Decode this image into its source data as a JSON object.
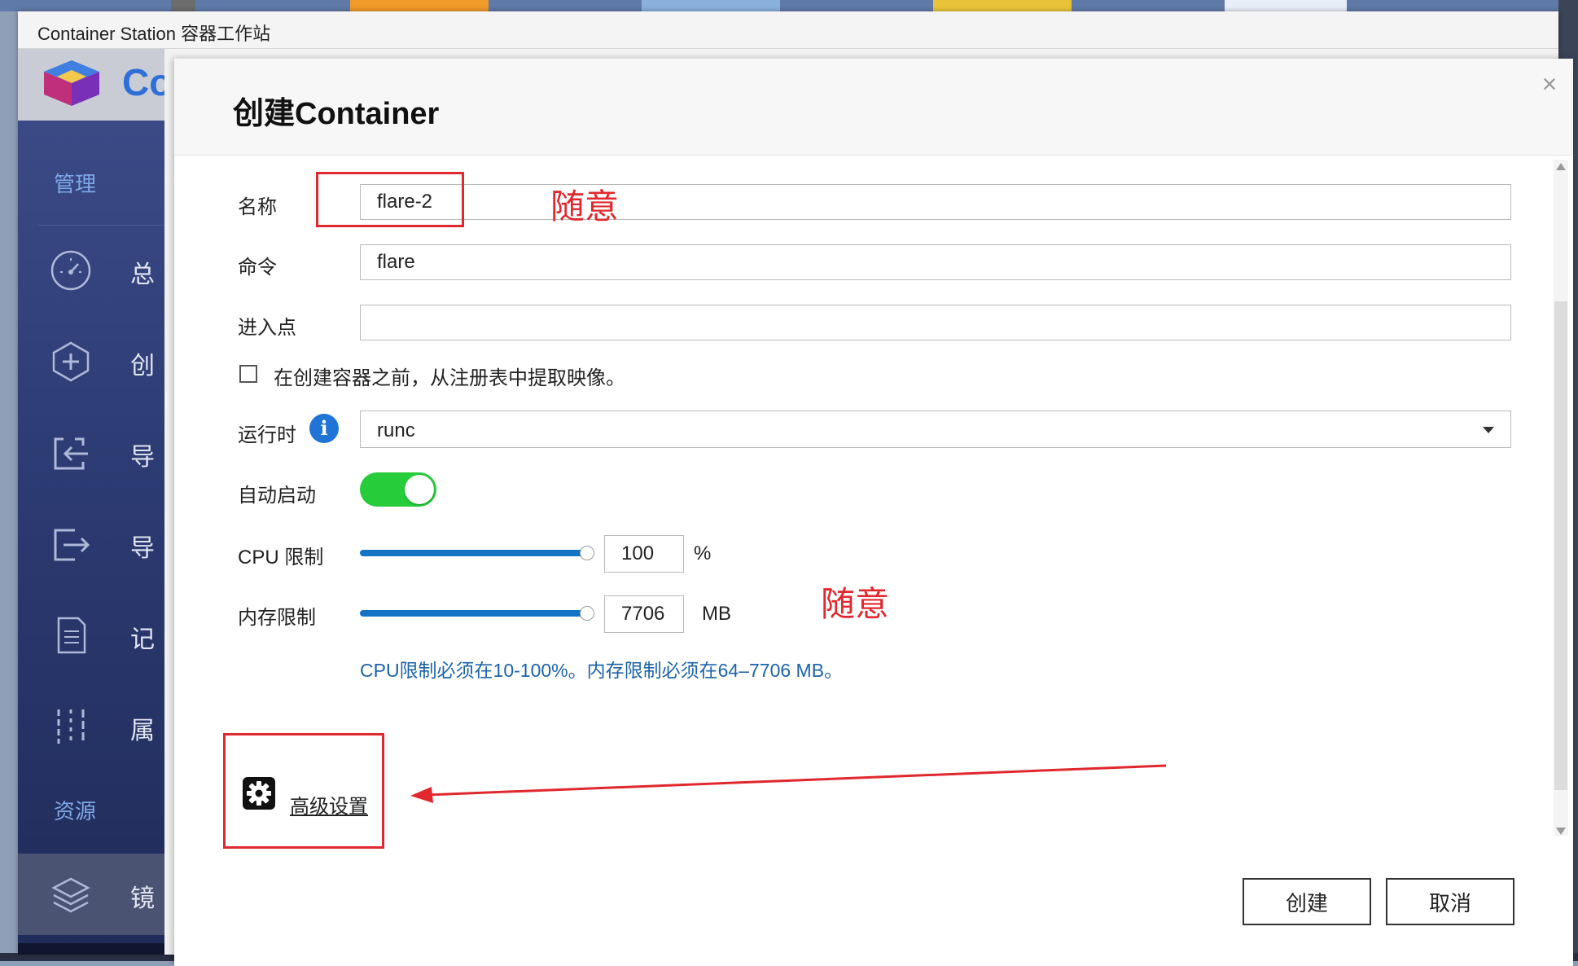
{
  "window": {
    "title": "Container Station 容器工作站"
  },
  "app": {
    "name_fragment": "Co"
  },
  "sidebar": {
    "section_manage": "管理",
    "section_resources": "资源",
    "items": [
      {
        "icon": "dashboard-icon",
        "label": "总"
      },
      {
        "icon": "create-plus-icon",
        "label": "创"
      },
      {
        "icon": "import-icon",
        "label": "导"
      },
      {
        "icon": "export-icon",
        "label": "导"
      },
      {
        "icon": "log-document-icon",
        "label": "记"
      },
      {
        "icon": "properties-sliders-icon",
        "label": "属"
      },
      {
        "icon": "layers-icon",
        "label": "镜"
      }
    ]
  },
  "dialog": {
    "title": "创建Container",
    "close_symbol": "×",
    "form": {
      "name": {
        "label": "名称",
        "value": "flare-2"
      },
      "command": {
        "label": "命令",
        "value": "flare"
      },
      "entrypoint": {
        "label": "进入点",
        "value": ""
      },
      "pull_image": {
        "label": "在创建容器之前，从注册表中提取映像。",
        "checked": false
      },
      "runtime": {
        "label": "运行时",
        "info_symbol": "i",
        "value": "runc"
      },
      "autostart": {
        "label": "自动启动",
        "enabled": true
      },
      "cpu_limit": {
        "label": "CPU 限制",
        "value": "100",
        "unit": "%",
        "slider_level": 1.0
      },
      "memory_limit": {
        "label": "内存限制",
        "value": "7706",
        "unit": "MB",
        "slider_level": 1.0
      },
      "hint": "CPU限制必须在10-100%。内存限制必须在64–7706 MB。"
    },
    "advanced_link": "高级设置",
    "buttons": {
      "create": "创建",
      "cancel": "取消"
    }
  },
  "annotations": {
    "note_text": "随意",
    "annotation_color": "#e0282e"
  },
  "colors": {
    "accent_blue": "#1573c6",
    "toggle_green": "#27cc3b",
    "hint_blue": "#1d63a8"
  }
}
